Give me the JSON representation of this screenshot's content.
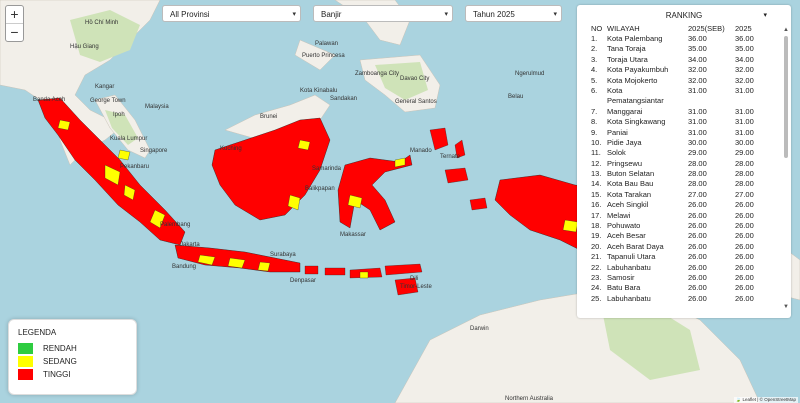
{
  "controls": {
    "zoom_in": "+",
    "zoom_out": "−",
    "province": "All Provinsi",
    "disaster": "Banjir",
    "year": "Tahun 2025",
    "caret": "▾"
  },
  "map_labels": {
    "banda_aceh": "Banda Aceh",
    "george_town": "George Town",
    "kangar": "Kangar",
    "ipoh": "Ipoh",
    "kuala_lumpur": "Kuala Lumpur",
    "malaysia": "Malaysia",
    "singapore": "Singapore",
    "pekanbaru": "Pekanbaru",
    "kuching": "Kuching",
    "brunei": "Brunei",
    "kota_kinabalu": "Kota Kinabalu",
    "sandakan": "Sandakan",
    "palawan": "Palawan",
    "puerto_princesa": "Puerto Princesa",
    "zamboanga": "Zamboanga City",
    "davao": "Davao City",
    "general_santos": "General Santos",
    "ho_chi_minh": "Hồ Chí Minh",
    "hau_giang": "Hậu Giang",
    "samarinda": "Samarinda",
    "balikpapan": "Balikpapan",
    "manado": "Manado",
    "ternate": "Ternate",
    "ngerulmud": "Ngerulmud",
    "belau": "Belau",
    "palembang": "Palembang",
    "jakarta": "Jakarta",
    "bandung": "Bandung",
    "surabaya": "Surabaya",
    "denpasar": "Denpasar",
    "makassar": "Makassar",
    "timor_leste": "Timor-Leste",
    "dili": "Dili",
    "darwin": "Darwin",
    "northern_australia": "Northern Australia"
  },
  "ranking": {
    "title": "RANKING",
    "col_no": "NO",
    "col_wilayah": "WILAYAH",
    "col_prev": "2025(SEB)",
    "col_curr": "2025",
    "rows": [
      {
        "no": "1.",
        "wilayah": "Kota Palembang",
        "prev": "36.00",
        "curr": "36.00"
      },
      {
        "no": "2.",
        "wilayah": "Tana Toraja",
        "prev": "35.00",
        "curr": "35.00"
      },
      {
        "no": "3.",
        "wilayah": "Toraja Utara",
        "prev": "34.00",
        "curr": "34.00"
      },
      {
        "no": "4.",
        "wilayah": "Kota Payakumbuh",
        "prev": "32.00",
        "curr": "32.00"
      },
      {
        "no": "5.",
        "wilayah": "Kota Mojokerto",
        "prev": "32.00",
        "curr": "32.00"
      },
      {
        "no": "6.",
        "wilayah": "Kota",
        "prev": "31.00",
        "curr": "31.00"
      },
      {
        "no": "",
        "wilayah": "Pematangsiantar",
        "prev": "",
        "curr": ""
      },
      {
        "no": "7.",
        "wilayah": "Manggarai",
        "prev": "31.00",
        "curr": "31.00"
      },
      {
        "no": "8.",
        "wilayah": "Kota Singkawang",
        "prev": "31.00",
        "curr": "31.00"
      },
      {
        "no": "9.",
        "wilayah": "Paniai",
        "prev": "31.00",
        "curr": "31.00"
      },
      {
        "no": "10.",
        "wilayah": "Pidie Jaya",
        "prev": "30.00",
        "curr": "30.00"
      },
      {
        "no": "11.",
        "wilayah": "Solok",
        "prev": "29.00",
        "curr": "29.00"
      },
      {
        "no": "12.",
        "wilayah": "Pringsewu",
        "prev": "28.00",
        "curr": "28.00"
      },
      {
        "no": "13.",
        "wilayah": "Buton Selatan",
        "prev": "28.00",
        "curr": "28.00"
      },
      {
        "no": "14.",
        "wilayah": "Kota Bau Bau",
        "prev": "28.00",
        "curr": "28.00"
      },
      {
        "no": "15.",
        "wilayah": "Kota Tarakan",
        "prev": "27.00",
        "curr": "27.00"
      },
      {
        "no": "16.",
        "wilayah": "Aceh Singkil",
        "prev": "26.00",
        "curr": "26.00"
      },
      {
        "no": "17.",
        "wilayah": "Melawi",
        "prev": "26.00",
        "curr": "26.00"
      },
      {
        "no": "18.",
        "wilayah": "Pohuwato",
        "prev": "26.00",
        "curr": "26.00"
      },
      {
        "no": "19.",
        "wilayah": "Aceh Besar",
        "prev": "26.00",
        "curr": "26.00"
      },
      {
        "no": "20.",
        "wilayah": "Aceh Barat Daya",
        "prev": "26.00",
        "curr": "26.00"
      },
      {
        "no": "21.",
        "wilayah": "Tapanuli Utara",
        "prev": "26.00",
        "curr": "26.00"
      },
      {
        "no": "22.",
        "wilayah": "Labuhanbatu",
        "prev": "26.00",
        "curr": "26.00"
      },
      {
        "no": "23.",
        "wilayah": "Samosir",
        "prev": "26.00",
        "curr": "26.00"
      },
      {
        "no": "24.",
        "wilayah": "Batu Bara",
        "prev": "26.00",
        "curr": "26.00"
      },
      {
        "no": "25.",
        "wilayah": "Labuhanbatu",
        "prev": "26.00",
        "curr": "26.00"
      }
    ]
  },
  "legend": {
    "title": "LEGENDA",
    "items": [
      {
        "label": "RENDAH",
        "color": "#2ecc40"
      },
      {
        "label": "SEDANG",
        "color": "#ffff00"
      },
      {
        "label": "TINGGI",
        "color": "#ff0000"
      }
    ]
  },
  "colors": {
    "sea": "#aad3df",
    "land": "#f2efe9",
    "forest": "#cfe3b8",
    "high": "#ff0000",
    "medium": "#ffff00"
  },
  "attribution": "🍃 Leaflet | © OpenStreetMap"
}
